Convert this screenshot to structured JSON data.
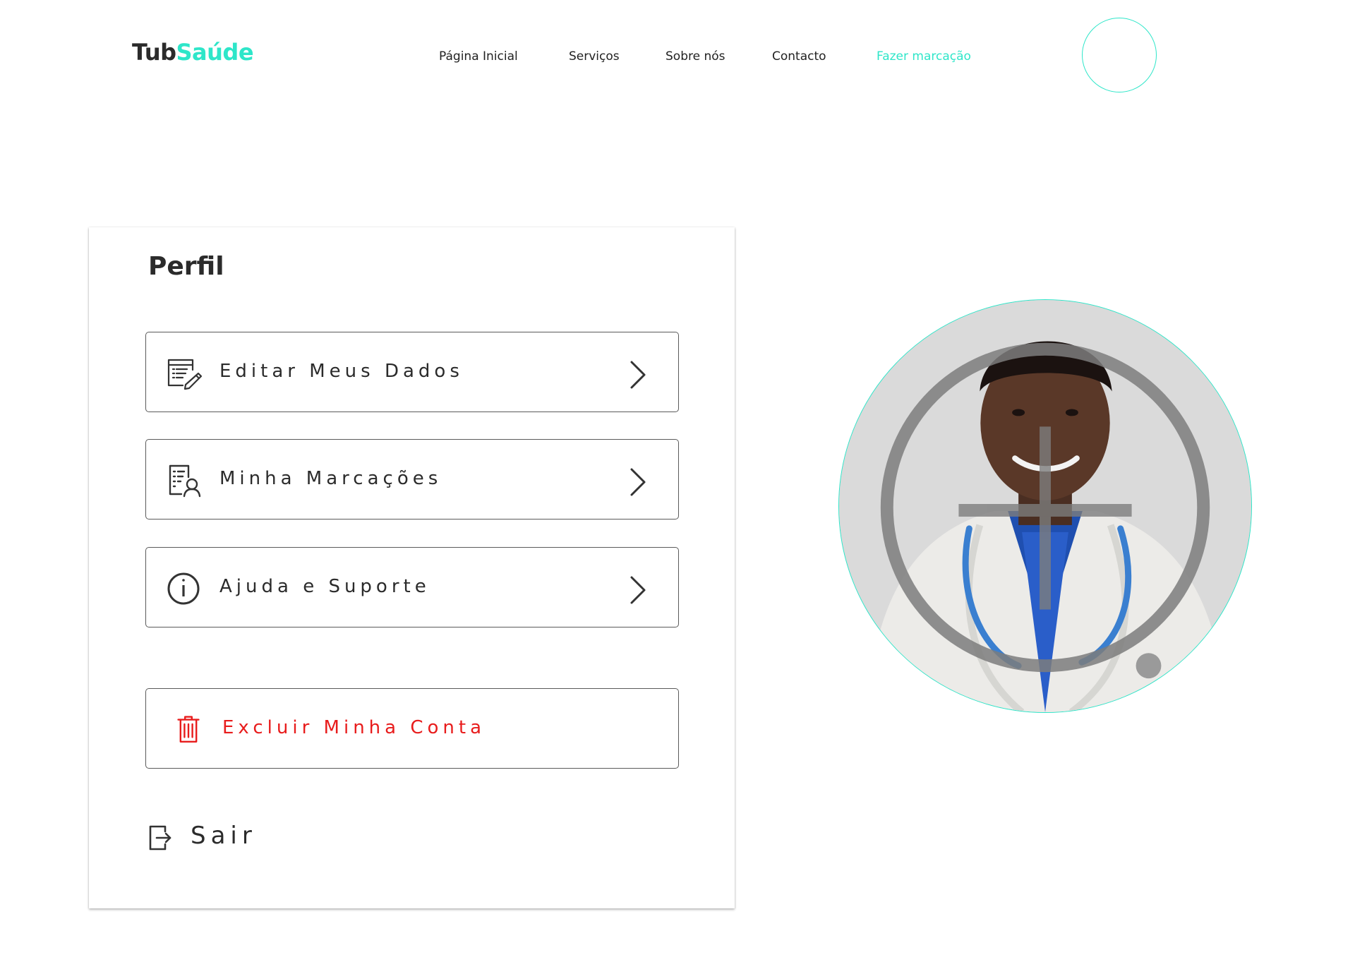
{
  "header": {
    "logo_part1": "Tub",
    "logo_part2": "Saúde",
    "nav": [
      {
        "label": "Página Inicial"
      },
      {
        "label": "Serviços"
      },
      {
        "label": "Sobre nós"
      },
      {
        "label": "Contacto"
      },
      {
        "label": "Fazer marcação",
        "active": true
      }
    ],
    "accent_color": "#2ee6c9"
  },
  "profile": {
    "title": "Perfil",
    "menu": [
      {
        "label": "Editar Meus Dados",
        "icon": "edit-document-icon"
      },
      {
        "label": "Minha Marcações",
        "icon": "appointments-person-icon"
      },
      {
        "label": "Ajuda e Suporte",
        "icon": "info-icon"
      }
    ],
    "delete_account": {
      "label": "Excluir Minha Conta",
      "icon": "trash-icon",
      "color": "#e81c1c"
    },
    "logout": {
      "label": "Sair",
      "icon": "logout-icon"
    }
  },
  "avatar": {
    "icon": "user-avatar-icon",
    "description_icon": "doctor-photo"
  }
}
